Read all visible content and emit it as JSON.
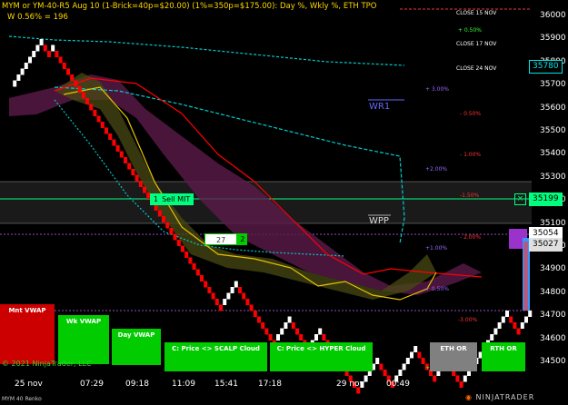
{
  "header": {
    "title": "MYM or YM-40-R5 Aug 10 (1-Brick=40p=$20.00) (1%=350p=$175.00): Day %, Wkly %, ETH TPO",
    "sub": "W 0.56% = 196"
  },
  "status_bar": {
    "instrument": "MYM 40 Renko",
    "brand": "NINJATRADER",
    "copyright": "© 2021 NinjaTrader, LLC"
  },
  "price_axis": {
    "labels": [
      "36000",
      "35900",
      "35800",
      "35700",
      "35600",
      "35500",
      "35400",
      "35300",
      "35200",
      "35100",
      "35000",
      "34900",
      "34800",
      "34700",
      "34600",
      "34500"
    ],
    "tags": [
      {
        "text": "35780",
        "bg": "#000000",
        "fg": "#00e5e5",
        "border": "#00e5e5"
      },
      {
        "text": "35199",
        "bg": "#00ff7f",
        "fg": "#000000",
        "border": "#00ff7f"
      },
      {
        "text": "35054",
        "bg": "#ffffff",
        "fg": "#000000",
        "border": "#ffffff"
      },
      {
        "text": "35027",
        "bg": "#e0e0e0",
        "fg": "#000000",
        "border": "#e0e0e0"
      }
    ]
  },
  "time_axis": [
    "25 nov",
    "07:29",
    "09:18",
    "11:09",
    "15:41",
    "17:18",
    "29 nov",
    "00:49"
  ],
  "levels": [
    {
      "text": "CLOSE 15 NOV",
      "color": "#ffffff"
    },
    {
      "text": "+ 0.50%",
      "color": "#33ff33"
    },
    {
      "text": "CLOSE 17 NOV",
      "color": "#ffffff"
    },
    {
      "text": "CLOSE 24 NOV",
      "color": "#ffffff"
    },
    {
      "text": "+ 3.00%",
      "color": "#9966ff"
    },
    {
      "text": "- 0.50%",
      "color": "#ff3333"
    },
    {
      "text": "- 1.00%",
      "color": "#ff3333"
    },
    {
      "text": "+2.00%",
      "color": "#9966ff"
    },
    {
      "text": "-1.50%",
      "color": "#ff3333"
    },
    {
      "text": "- 2.00%",
      "color": "#ff3333"
    },
    {
      "text": "+1.00%",
      "color": "#9966ff"
    },
    {
      "text": "+ 0.50%",
      "color": "#9966ff"
    },
    {
      "text": "-3.00%",
      "color": "#ff3333"
    },
    {
      "text": "+1.00%",
      "color": "#33ff33"
    }
  ],
  "annotations": {
    "wr1": "WR1",
    "wpp": "WPP"
  },
  "order": {
    "label": "Sell MIT",
    "qty": "1",
    "close_icon": "x-close-icon"
  },
  "order2": {
    "price": "27",
    "qty": "2"
  },
  "buttons": {
    "mnt_vwap": "Mnt VWAP",
    "wk_vwap": "Wk VWAP",
    "day_vwap": "Day VWAP",
    "scalp_cloud": "C: Price <> SCALP Cloud",
    "hyper_cloud": "C: Price <> HYPER Cloud",
    "eth_or": "ETH OR",
    "rth_or": "RTH OR"
  },
  "colors": {
    "bull_brick": "#ffffff",
    "bear_brick": "#ff0000",
    "cyan_line": "#00cccc",
    "red_line": "#ff0000",
    "yellow_line": "#e6c200",
    "purple_line": "#aa66ff",
    "green_button": "#00cc00",
    "red_button": "#cc0000",
    "gray_button": "#808080"
  }
}
